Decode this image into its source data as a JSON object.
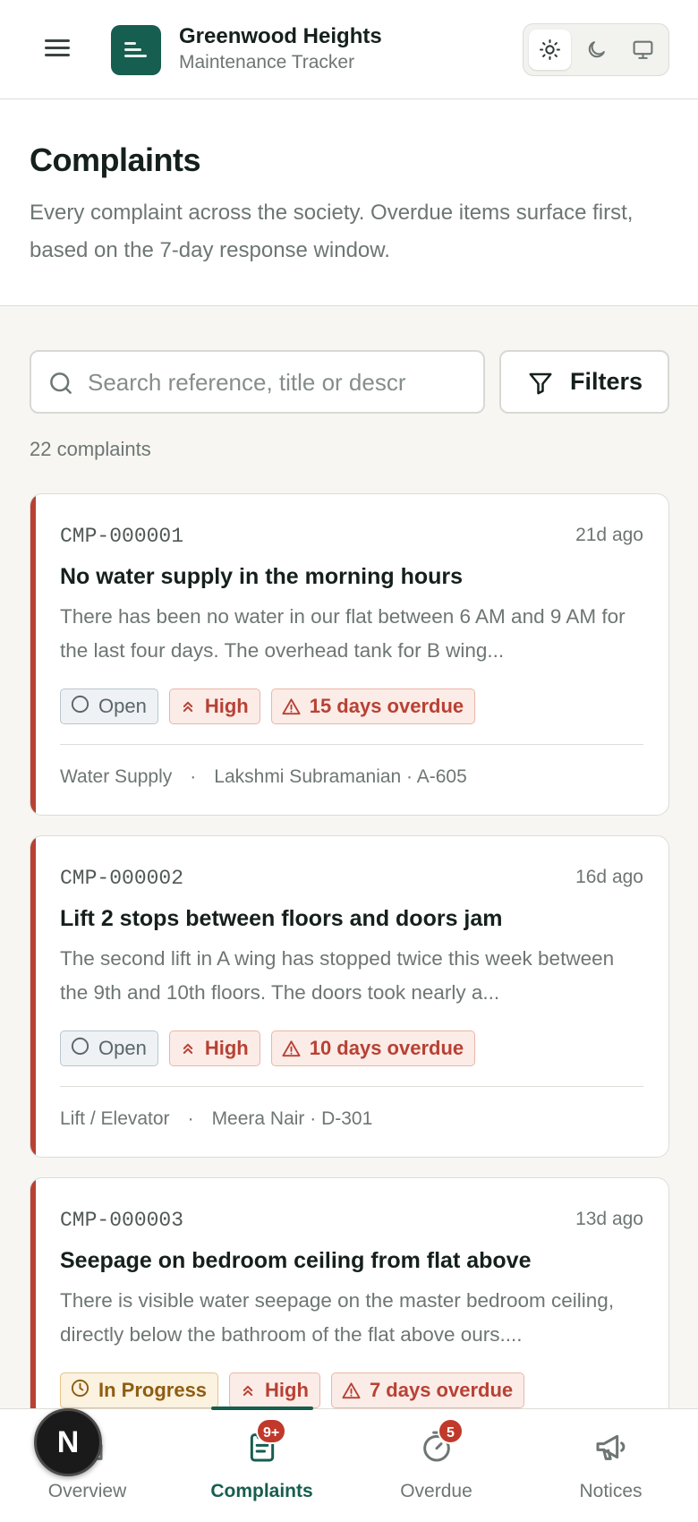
{
  "header": {
    "app_title": "Greenwood Heights",
    "app_subtitle": "Maintenance Tracker",
    "theme_options": [
      "light",
      "dark",
      "system"
    ],
    "theme_selected": "light"
  },
  "page": {
    "title": "Complaints",
    "description": "Every complaint across the society. Overdue items surface first, based on the 7-day response window."
  },
  "search": {
    "placeholder": "Search reference, title or descr",
    "value": ""
  },
  "filters_label": "Filters",
  "count_label": "22 complaints",
  "complaints": [
    {
      "ref": "CMP-000001",
      "age": "21d ago",
      "title": "No water supply in the morning hours",
      "description": "There has been no water in our flat between 6 AM and 9 AM for the last four days. The overhead tank for B wing...",
      "status": "Open",
      "priority": "High",
      "overdue": "15 days overdue",
      "category": "Water Supply",
      "resident": "Lakshmi Subramanian · A-605"
    },
    {
      "ref": "CMP-000002",
      "age": "16d ago",
      "title": "Lift 2 stops between floors and doors jam",
      "description": "The second lift in A wing has stopped twice this week between the 9th and 10th floors. The doors took nearly a...",
      "status": "Open",
      "priority": "High",
      "overdue": "10 days overdue",
      "category": "Lift / Elevator",
      "resident": "Meera Nair · D-301"
    },
    {
      "ref": "CMP-000003",
      "age": "13d ago",
      "title": "Seepage on bedroom ceiling from flat above",
      "description": "There is visible water seepage on the master bedroom ceiling, directly below the bathroom of the flat above ours....",
      "status": "In Progress",
      "priority": "High",
      "overdue": "7 days overdue",
      "category": "",
      "resident": ""
    }
  ],
  "nav": {
    "items": [
      {
        "label": "Overview",
        "icon": "home-icon"
      },
      {
        "label": "Complaints",
        "icon": "clipboard-icon",
        "badge": "9+"
      },
      {
        "label": "Overdue",
        "icon": "timer-icon",
        "badge": "5"
      },
      {
        "label": "Notices",
        "icon": "megaphone-icon"
      }
    ],
    "active": "Complaints"
  },
  "fab_label": "N",
  "colors": {
    "brand": "#165e4f",
    "overdue_accent": "#b84134",
    "badge_red": "#c0392b"
  }
}
